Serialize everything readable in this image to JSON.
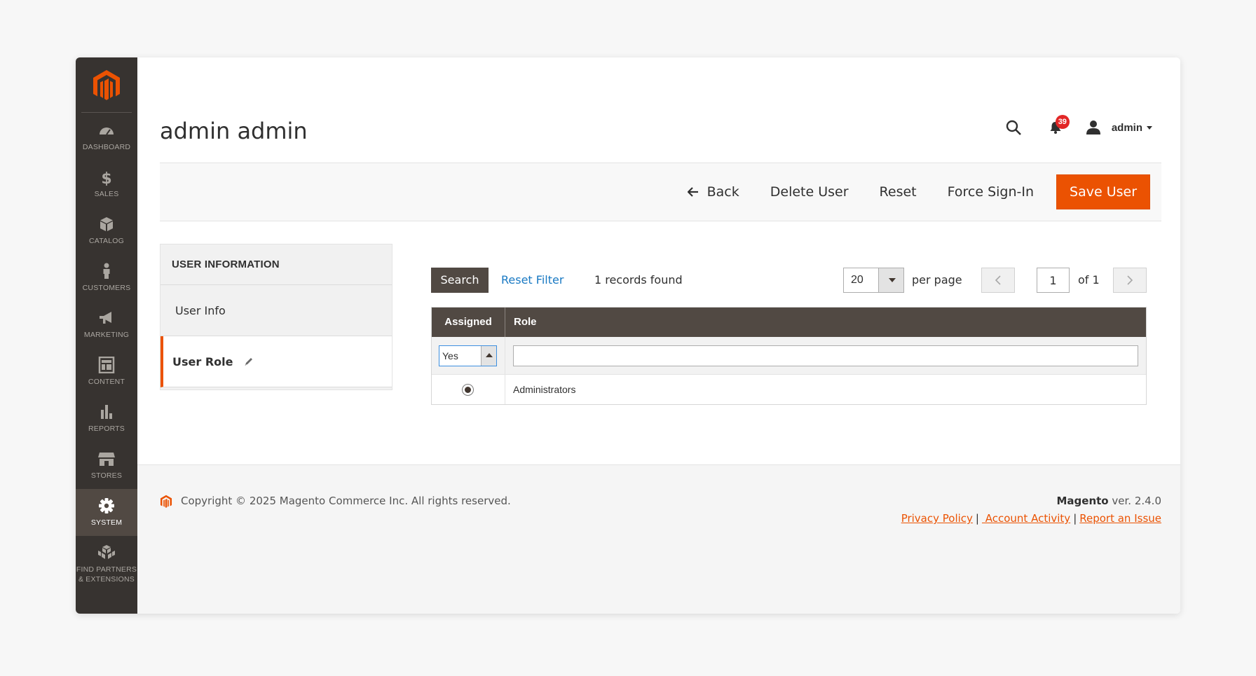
{
  "colors": {
    "accent": "#eb5202",
    "sidebar": "#373330",
    "grid_header": "#514943",
    "link": "#1979c3",
    "badge": "#e22626"
  },
  "sidebar": {
    "items": [
      {
        "label": "DASHBOARD",
        "icon": "dashboard-icon"
      },
      {
        "label": "SALES",
        "icon": "dollar-icon"
      },
      {
        "label": "CATALOG",
        "icon": "box-icon"
      },
      {
        "label": "CUSTOMERS",
        "icon": "person-icon"
      },
      {
        "label": "MARKETING",
        "icon": "megaphone-icon"
      },
      {
        "label": "CONTENT",
        "icon": "layout-icon"
      },
      {
        "label": "REPORTS",
        "icon": "bar-chart-icon"
      },
      {
        "label": "STORES",
        "icon": "storefront-icon"
      },
      {
        "label": "SYSTEM",
        "icon": "gear-icon",
        "active": true
      },
      {
        "label": "FIND PARTNERS",
        "label2": "& EXTENSIONS",
        "icon": "cubes-icon"
      }
    ]
  },
  "header": {
    "title": "admin admin",
    "notifications": "39",
    "user": "admin"
  },
  "actions": {
    "back": "Back",
    "delete": "Delete User",
    "reset": "Reset",
    "force_signin": "Force Sign-In",
    "save": "Save User"
  },
  "tabs": {
    "title": "USER INFORMATION",
    "items": [
      {
        "label": "User Info"
      },
      {
        "label": "User Role",
        "active": true
      }
    ]
  },
  "grid": {
    "search_label": "Search",
    "reset_filter": "Reset Filter",
    "records": "1 records found",
    "per_page_value": "20",
    "per_page_label": "per page",
    "page_value": "1",
    "page_of": "of 1",
    "columns": {
      "assigned": "Assigned",
      "role": "Role"
    },
    "filter": {
      "assigned": "Yes",
      "role": ""
    },
    "rows": [
      {
        "assigned": true,
        "role": "Administrators"
      }
    ]
  },
  "footer": {
    "copyright": "Copyright © 2025 Magento Commerce Inc. All rights reserved.",
    "brand": "Magento",
    "version": " ver. 2.4.0",
    "links": {
      "privacy": "Privacy Policy",
      "activity": " Account Activity",
      "report": "Report an Issue"
    },
    "separator": "|"
  }
}
